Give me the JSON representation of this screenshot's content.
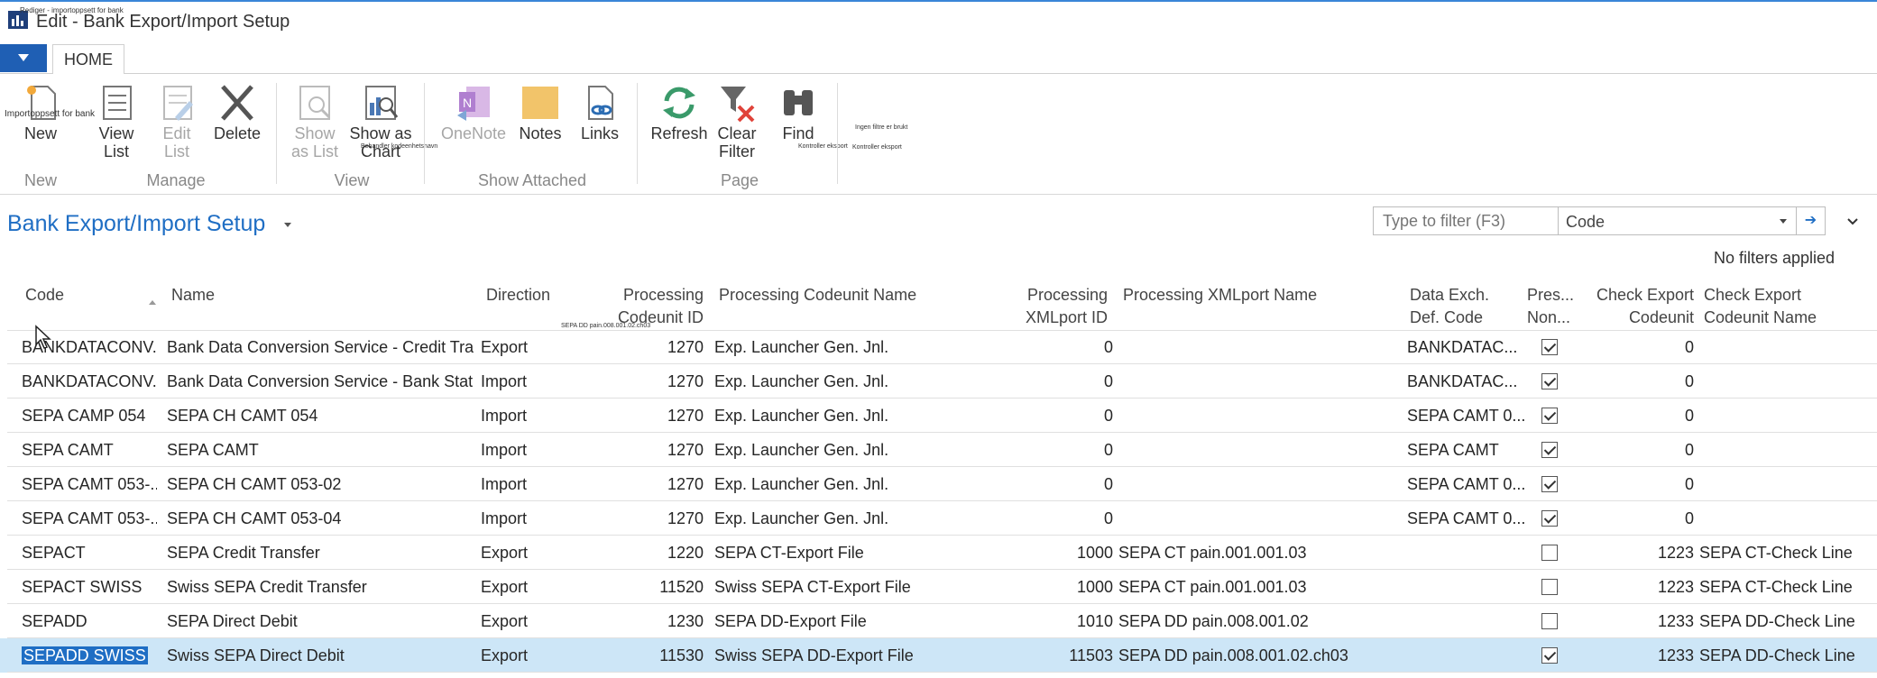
{
  "window": {
    "title": "Edit - Bank Export/Import Setup",
    "tiny_title": "Rediger - importoppsett for bank"
  },
  "ribbon": {
    "tab": "HOME",
    "tiny_new_overlay": "Importoppsett for bank",
    "tiny_show_chart_overlay": "Behandler kodeenhetsnavn",
    "tiny_find_overlay": "Kontroller eksport",
    "tiny_check_export": "Kontroller eksport",
    "tiny_no_filters": "Ingen filtre er brukt",
    "tiny_grid_overlay": "SEPA DD pain.008.001.02.ch03",
    "buttons": {
      "new": "New",
      "view_list_1": "View",
      "view_list_2": "List",
      "edit_list_1": "Edit",
      "edit_list_2": "List",
      "delete": "Delete",
      "show_as_list_1": "Show",
      "show_as_list_2": "as List",
      "show_as_chart_1": "Show as",
      "show_as_chart_2": "Chart",
      "onenote": "OneNote",
      "notes": "Notes",
      "links": "Links",
      "refresh": "Refresh",
      "clear_filter_1": "Clear",
      "clear_filter_2": "Filter",
      "find": "Find"
    },
    "groups": {
      "new": "New",
      "manage": "Manage",
      "view": "View",
      "show_attached": "Show Attached",
      "page": "Page"
    }
  },
  "page": {
    "title": "Bank Export/Import Setup",
    "filter_placeholder": "Type to filter (F3)",
    "filter_field": "Code",
    "filter_status": "No filters applied"
  },
  "columns": {
    "code": "Code",
    "name": "Name",
    "direction": "Direction",
    "proc_codeunit_id_1": "Processing",
    "proc_codeunit_id_2": "Codeunit ID",
    "proc_codeunit_name": "Processing Codeunit Name",
    "proc_xmlport_id_1": "Processing",
    "proc_xmlport_id_2": "XMLport ID",
    "proc_xmlport_name": "Processing XMLport Name",
    "data_exch_1": "Data Exch.",
    "data_exch_2": "Def. Code",
    "pres_non_1": "Pres...",
    "pres_non_2": "Non...",
    "check_export_cu_1": "Check Export",
    "check_export_cu_2": "Codeunit",
    "check_export_name_1": "Check Export",
    "check_export_name_2": "Codeunit Name"
  },
  "rows": [
    {
      "code": "BANKDATACONV...",
      "name": "Bank Data Conversion Service - Credit Tra...",
      "direction": "Export",
      "cu_id": "1270",
      "cu_name": "Exp. Launcher Gen. Jnl.",
      "xml_id": "0",
      "xml_name": "",
      "dx": "BANKDATAC...",
      "pres": true,
      "chk_cu": "0",
      "chk_name": ""
    },
    {
      "code": "BANKDATACONV...",
      "name": "Bank Data Conversion Service - Bank Stat...",
      "direction": "Import",
      "cu_id": "1270",
      "cu_name": "Exp. Launcher Gen. Jnl.",
      "xml_id": "0",
      "xml_name": "",
      "dx": "BANKDATAC...",
      "pres": true,
      "chk_cu": "0",
      "chk_name": ""
    },
    {
      "code": "SEPA CAMP 054",
      "name": "SEPA CH CAMT 054",
      "direction": "Import",
      "cu_id": "1270",
      "cu_name": "Exp. Launcher Gen. Jnl.",
      "xml_id": "0",
      "xml_name": "",
      "dx": "SEPA CAMT 0...",
      "pres": true,
      "chk_cu": "0",
      "chk_name": ""
    },
    {
      "code": "SEPA CAMT",
      "name": "SEPA CAMT",
      "direction": "Import",
      "cu_id": "1270",
      "cu_name": "Exp. Launcher Gen. Jnl.",
      "xml_id": "0",
      "xml_name": "",
      "dx": "SEPA CAMT",
      "pres": true,
      "chk_cu": "0",
      "chk_name": ""
    },
    {
      "code": "SEPA CAMT 053-...",
      "name": "SEPA CH CAMT 053-02",
      "direction": "Import",
      "cu_id": "1270",
      "cu_name": "Exp. Launcher Gen. Jnl.",
      "xml_id": "0",
      "xml_name": "",
      "dx": "SEPA CAMT 0...",
      "pres": true,
      "chk_cu": "0",
      "chk_name": ""
    },
    {
      "code": "SEPA CAMT 053-...",
      "name": "SEPA CH CAMT 053-04",
      "direction": "Import",
      "cu_id": "1270",
      "cu_name": "Exp. Launcher Gen. Jnl.",
      "xml_id": "0",
      "xml_name": "",
      "dx": "SEPA CAMT 0...",
      "pres": true,
      "chk_cu": "0",
      "chk_name": ""
    },
    {
      "code": "SEPACT",
      "name": "SEPA Credit Transfer",
      "direction": "Export",
      "cu_id": "1220",
      "cu_name": "SEPA CT-Export File",
      "xml_id": "1000",
      "xml_name": "SEPA CT pain.001.001.03",
      "dx": "",
      "pres": false,
      "chk_cu": "1223",
      "chk_name": "SEPA CT-Check Line"
    },
    {
      "code": "SEPACT SWISS",
      "name": "Swiss SEPA Credit Transfer",
      "direction": "Export",
      "cu_id": "11520",
      "cu_name": "Swiss SEPA CT-Export File",
      "xml_id": "1000",
      "xml_name": "SEPA CT pain.001.001.03",
      "dx": "",
      "pres": false,
      "chk_cu": "1223",
      "chk_name": "SEPA CT-Check Line"
    },
    {
      "code": "SEPADD",
      "name": "SEPA Direct Debit",
      "direction": "Export",
      "cu_id": "1230",
      "cu_name": "SEPA DD-Export File",
      "xml_id": "1010",
      "xml_name": "SEPA DD pain.008.001.02",
      "dx": "",
      "pres": false,
      "chk_cu": "1233",
      "chk_name": "SEPA DD-Check Line"
    },
    {
      "code": "SEPADD SWISS",
      "name": "Swiss SEPA Direct Debit",
      "direction": "Export",
      "cu_id": "11530",
      "cu_name": "Swiss SEPA DD-Export File",
      "xml_id": "11503",
      "xml_name": "SEPA DD pain.008.001.02.ch03",
      "dx": "",
      "pres": true,
      "chk_cu": "1233",
      "chk_name": "SEPA DD-Check Line",
      "selected": true
    }
  ]
}
